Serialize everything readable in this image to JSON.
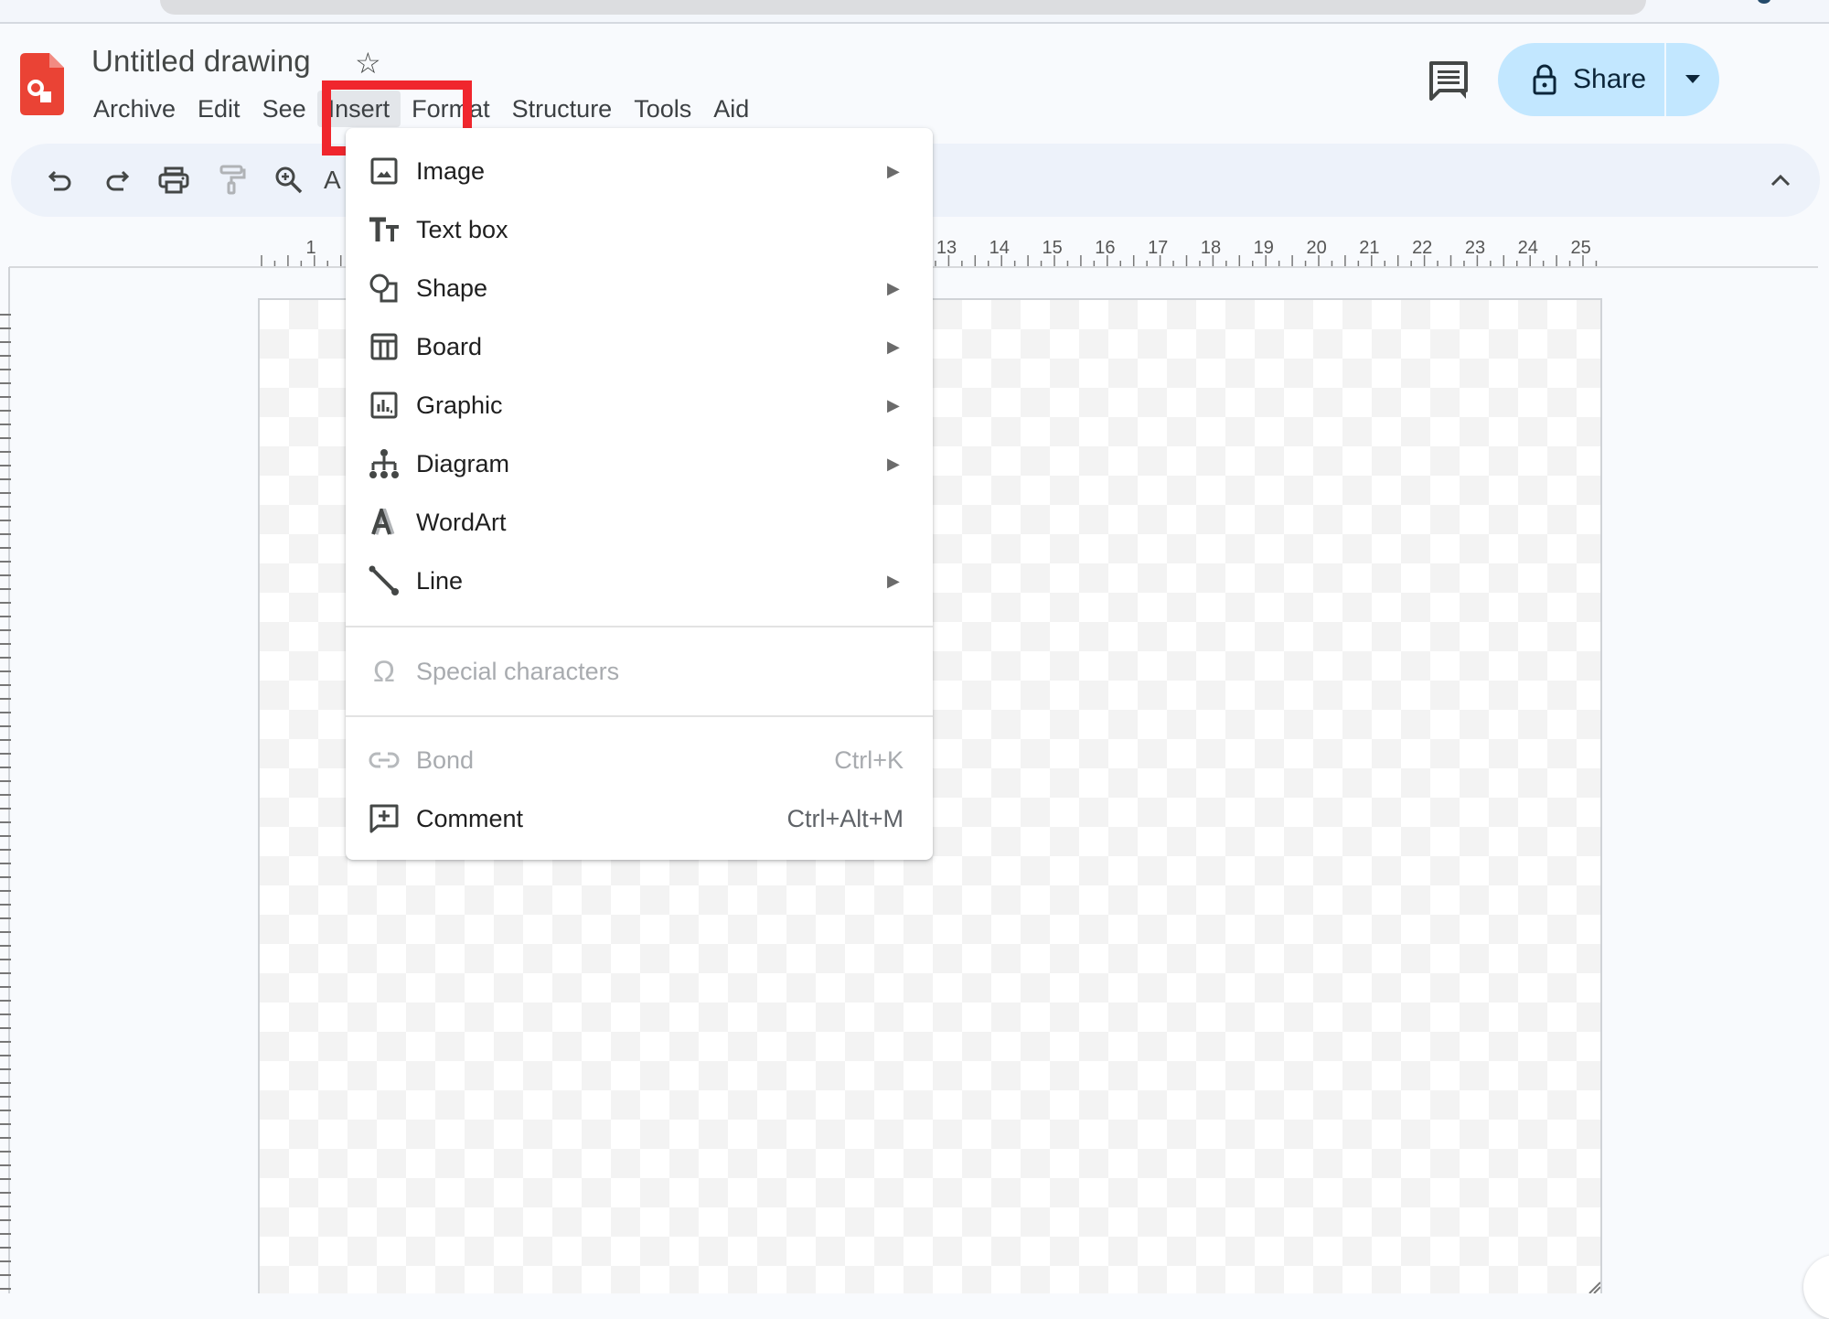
{
  "document": {
    "title": "Untitled drawing"
  },
  "menubar": {
    "items": [
      "Archive",
      "Edit",
      "See",
      "Insert",
      "Format",
      "Structure",
      "Tools",
      "Aid"
    ],
    "active": "Insert"
  },
  "header": {
    "share_label": "Share"
  },
  "toolbar": {
    "buttons": [
      "undo",
      "redo",
      "print",
      "paint-format",
      "zoom",
      "select"
    ],
    "partial_label": "A"
  },
  "ruler": {
    "visible_start_label": "1",
    "labels_right": [
      "13",
      "14",
      "15",
      "16",
      "17",
      "18",
      "19",
      "20",
      "21",
      "22",
      "23",
      "24",
      "25"
    ]
  },
  "insert_menu": {
    "items": [
      {
        "label": "Image",
        "icon": "image-icon",
        "submenu": true,
        "enabled": true
      },
      {
        "label": "Text box",
        "icon": "text-box-icon",
        "submenu": false,
        "enabled": true
      },
      {
        "label": "Shape",
        "icon": "shape-icon",
        "submenu": true,
        "enabled": true
      },
      {
        "label": "Board",
        "icon": "table-icon",
        "submenu": true,
        "enabled": true
      },
      {
        "label": "Graphic",
        "icon": "chart-icon",
        "submenu": true,
        "enabled": true
      },
      {
        "label": "Diagram",
        "icon": "diagram-icon",
        "submenu": true,
        "enabled": true
      },
      {
        "label": "WordArt",
        "icon": "wordart-icon",
        "submenu": false,
        "enabled": true
      },
      {
        "label": "Line",
        "icon": "line-icon",
        "submenu": true,
        "enabled": true
      },
      {
        "label": "Special characters",
        "icon": "omega-icon",
        "submenu": false,
        "enabled": false
      },
      {
        "label": "Bond",
        "icon": "link-icon",
        "shortcut": "Ctrl+K",
        "submenu": false,
        "enabled": false
      },
      {
        "label": "Comment",
        "icon": "add-comment-icon",
        "shortcut": "Ctrl+Alt+M",
        "submenu": false,
        "enabled": true
      }
    ]
  },
  "colors": {
    "accent_share": "#c2e7ff",
    "highlight": "#f0262d",
    "logo": "#ea4335"
  }
}
